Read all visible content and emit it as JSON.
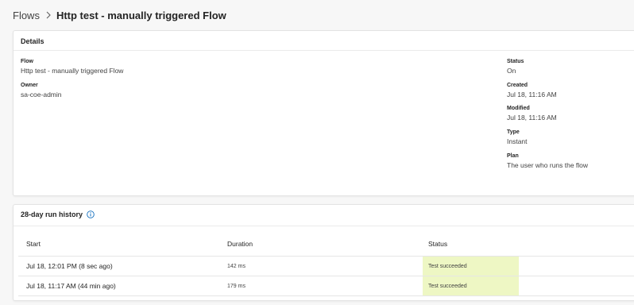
{
  "breadcrumb": {
    "root": "Flows",
    "current": "Http test - manually triggered Flow"
  },
  "details": {
    "title": "Details",
    "flow": {
      "label": "Flow",
      "value": "Http test - manually triggered Flow"
    },
    "owner": {
      "label": "Owner",
      "value": "sa-coe-admin"
    },
    "status": {
      "label": "Status",
      "value": "On"
    },
    "created": {
      "label": "Created",
      "value": "Jul 18, 11:16 AM"
    },
    "modified": {
      "label": "Modified",
      "value": "Jul 18, 11:16 AM"
    },
    "type": {
      "label": "Type",
      "value": "Instant"
    },
    "plan": {
      "label": "Plan",
      "value": "The user who runs the flow"
    }
  },
  "history": {
    "title": "28-day run history",
    "info_icon": "info-icon",
    "columns": {
      "start": "Start",
      "duration": "Duration",
      "status": "Status"
    },
    "rows": [
      {
        "start": "Jul 18, 12:01 PM (8 sec ago)",
        "duration": "142 ms",
        "status": "Test succeeded"
      },
      {
        "start": "Jul 18, 11:17 AM (44 min ago)",
        "duration": "179 ms",
        "status": "Test succeeded"
      }
    ]
  },
  "colors": {
    "success_bg": "#eef7c4",
    "info_icon": "#0f6cbd"
  }
}
